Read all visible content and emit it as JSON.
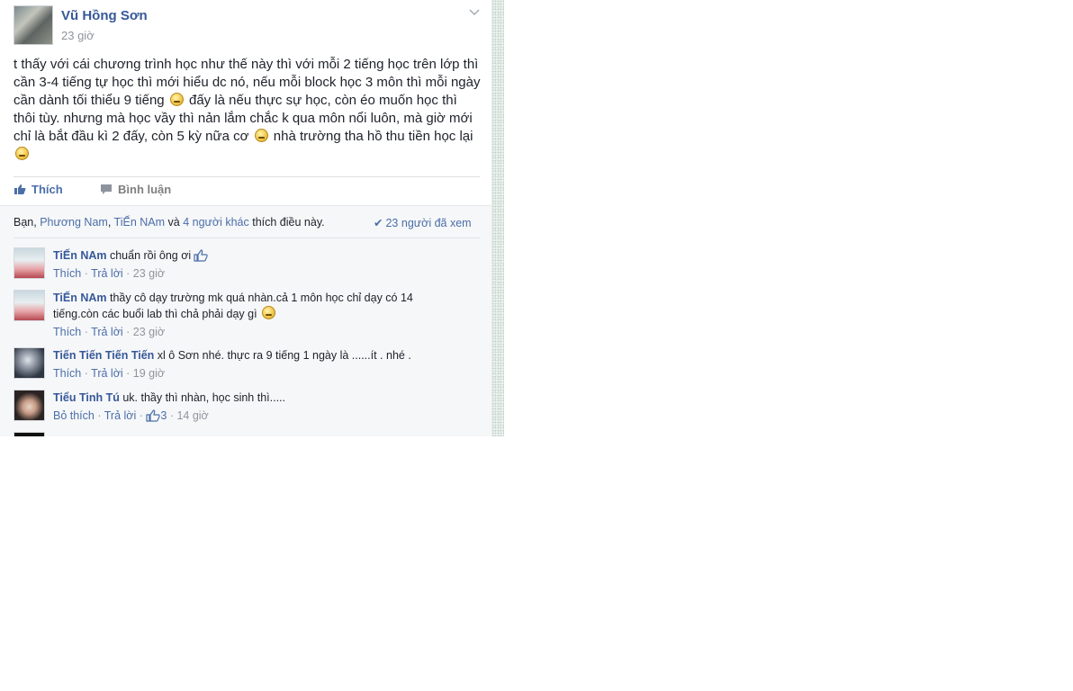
{
  "post": {
    "author": "Vũ Hồng Sơn",
    "time": "23 giờ",
    "text_part1": "t thấy với cái chương trình học như thế này thì với mỗi 2 tiếng học trên lớp thì cần 3-4 tiếng tự học thì mới hiểu dc nó, nếu mỗi block học 3 môn thì mỗi ngày cần dành tối thiểu 9 tiếng",
    "text_part2": "đấy là nếu thực sự học, còn éo muốn học thì thôi tùy. nhưng mà học vầy thì nản lắm chắc k qua môn nổi luôn, mà giờ mới chỉ là bắt đầu kì 2 đấy, còn 5 kỳ nữa cơ",
    "text_part3": "nhà trường tha hồ thu tiền học lại"
  },
  "actions": {
    "like": "Thích",
    "comment": "Bình luận"
  },
  "likes_line": {
    "prefix": "Bạn, ",
    "name1": "Phương Nam",
    "sep": ", ",
    "name2": "TiẾn NAm",
    "middle": " và ",
    "others": "4 người khác",
    "suffix": " thích điều này."
  },
  "seen": "23 người đã xem",
  "comments": [
    {
      "name": "TiẾn NAm",
      "text": "chuẩn rồi ông ơi",
      "like": "Thích",
      "reply": "Trả lời",
      "time": "23 giờ"
    },
    {
      "name": "TiẾn NAm",
      "text": "thầy cô dạy trường mk quá nhàn.cả 1 môn học chỉ dạy có 14 tiếng.còn các buổi lab thì chả phải dạy gì",
      "like": "Thích",
      "reply": "Trả lời",
      "time": "23 giờ"
    },
    {
      "name": "Tiến Tiến Tiến Tiến",
      "text": "xl ô Sơn nhé. thực ra 9 tiếng 1 ngày là ......ít . nhé .",
      "like": "Thích",
      "reply": "Trả lời",
      "time": "19 giờ"
    },
    {
      "name": "Tiểu Tinh Tú",
      "text": "uk. thầy thì nhàn, học sinh thì.....",
      "like": "Bỏ thích",
      "reply": "Trả lời",
      "likes_count": "3",
      "time": "14 giờ"
    }
  ],
  "colors": {
    "link": "#365899",
    "meta": "#90949c",
    "comment_bg": "#f6f7f9"
  }
}
